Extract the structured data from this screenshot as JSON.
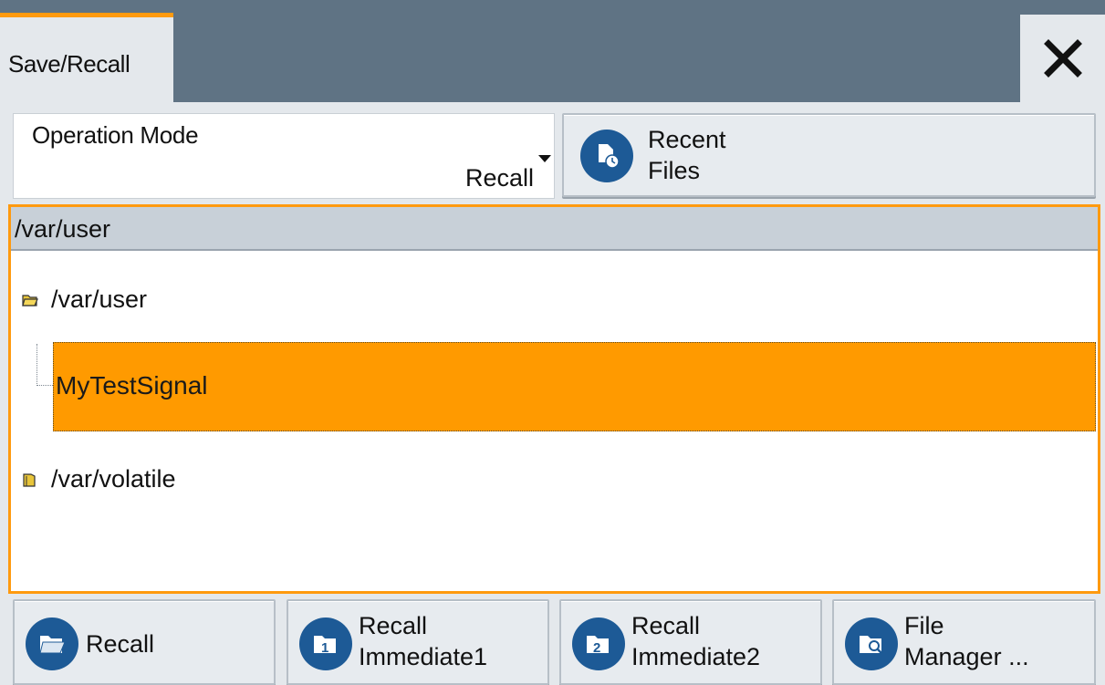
{
  "window": {
    "tab_label": "Save/Recall",
    "close_symbol": "✕"
  },
  "operation_mode": {
    "label": "Operation Mode",
    "value": "Recall"
  },
  "recent_files": {
    "label_line1": "Recent",
    "label_line2": "Files",
    "icon": "recent-files-icon"
  },
  "browser": {
    "current_path": "/var/user",
    "items": [
      {
        "label": "/var/user",
        "type": "folder-open"
      },
      {
        "label": "MyTestSignal",
        "type": "file",
        "selected": true
      },
      {
        "label": "/var/volatile",
        "type": "folder"
      }
    ]
  },
  "toolbar": {
    "recall": {
      "label": "Recall",
      "icon": "recall-folder-icon"
    },
    "recall_immediate1": {
      "line1": "Recall",
      "line2": "Immediate1",
      "icon": "recall-immediate-1-icon"
    },
    "recall_immediate2": {
      "line1": "Recall",
      "line2": "Immediate2",
      "icon": "recall-immediate-2-icon"
    },
    "file_manager": {
      "line1": "File",
      "line2": "Manager ...",
      "icon": "file-manager-icon"
    }
  },
  "colors": {
    "accent": "#ff9a0f",
    "titlebar": "#5f7384",
    "icon_blue": "#1d5a96",
    "selection": "#ff9a00"
  }
}
